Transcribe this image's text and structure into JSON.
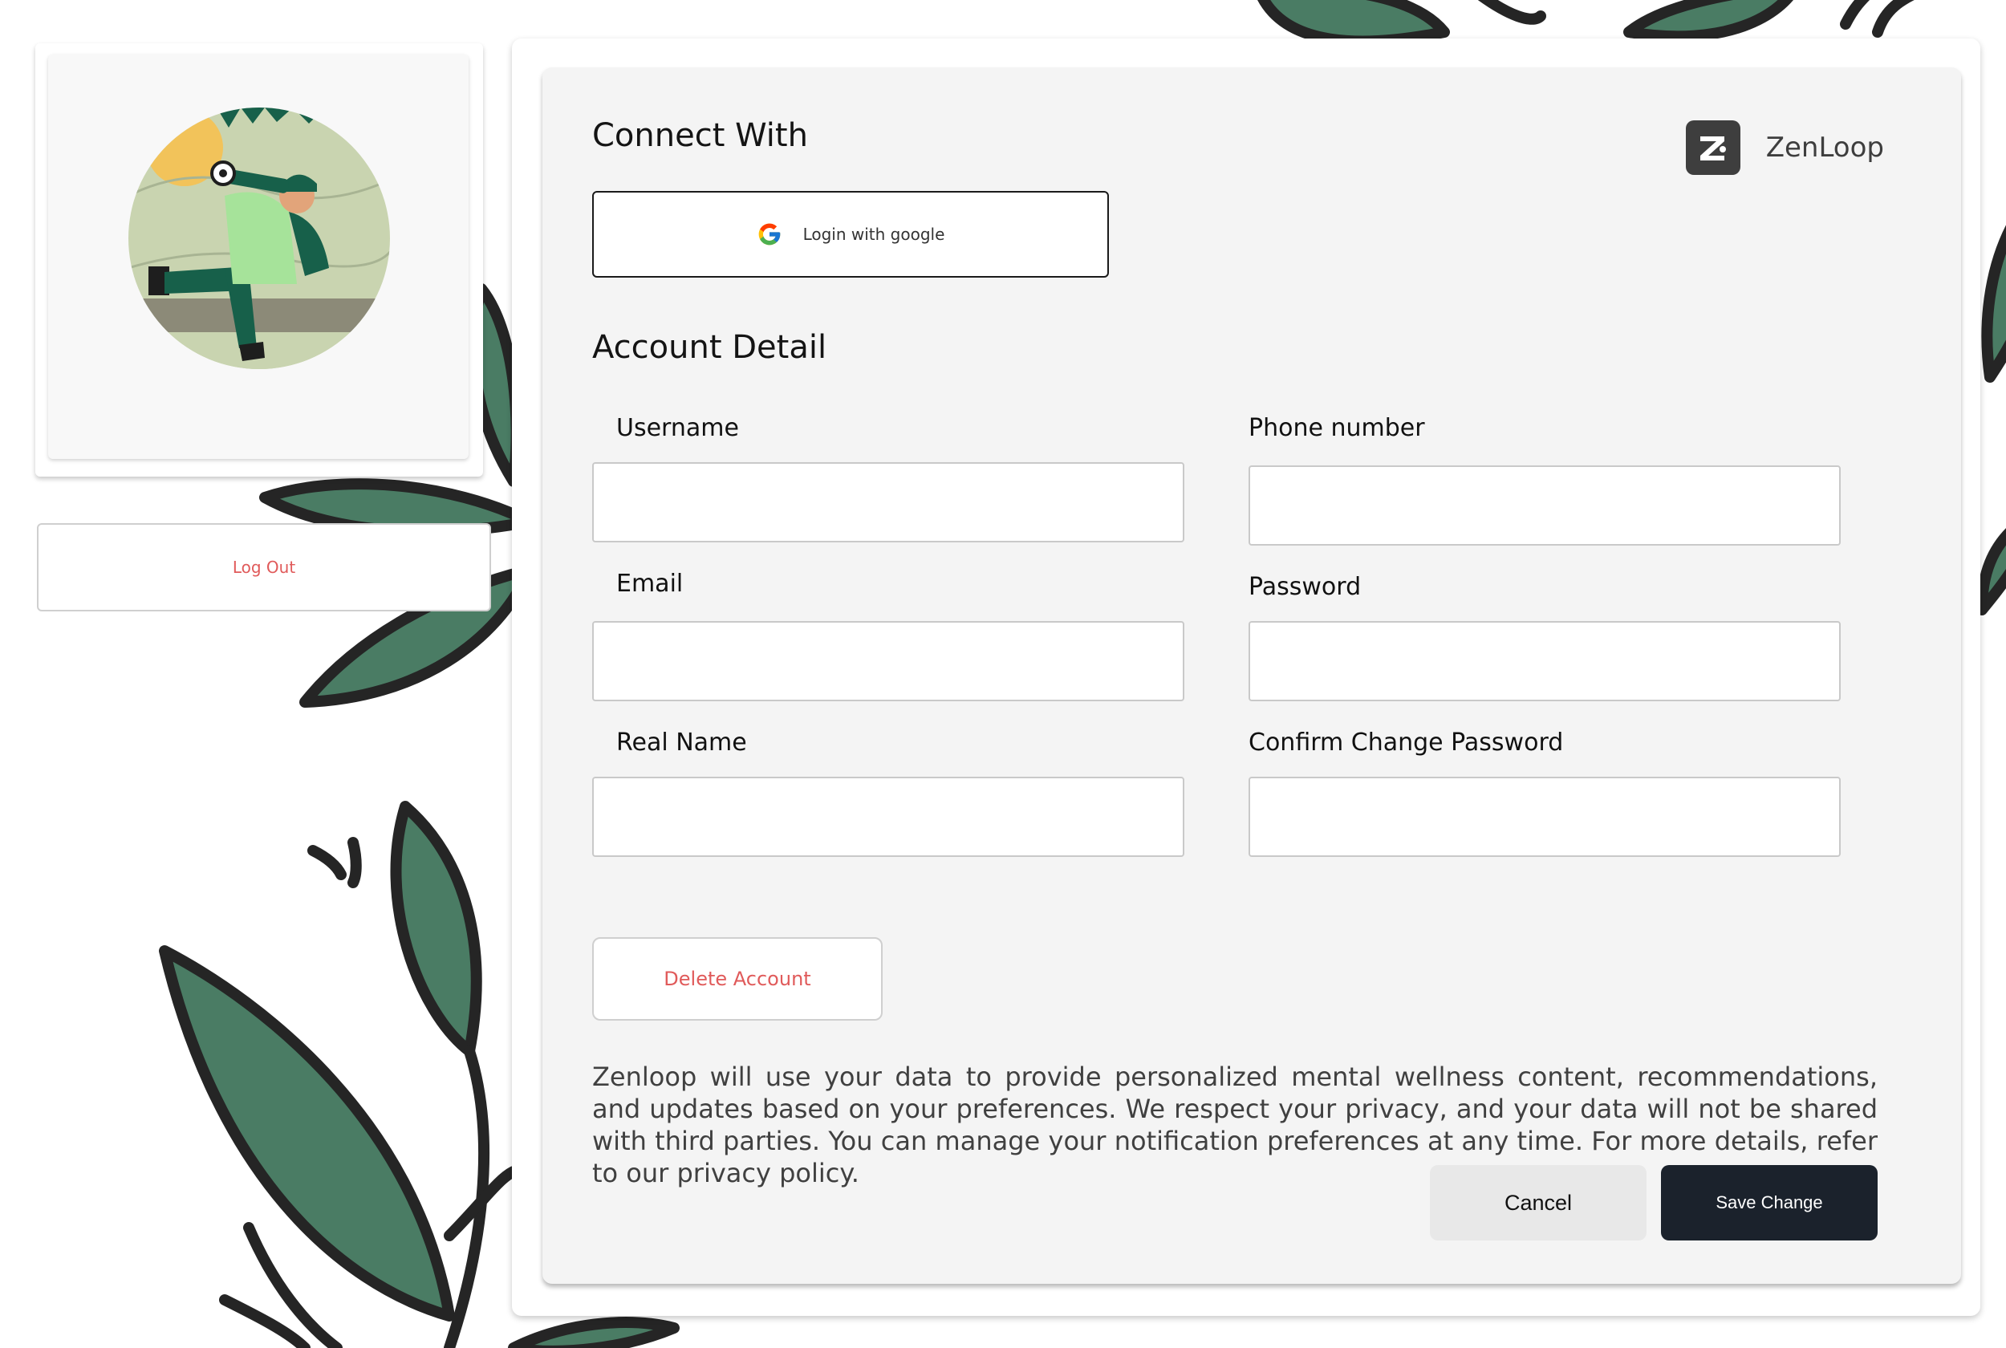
{
  "sidebar": {
    "avatar_alt": "person-with-telescope-illustration",
    "logout_label": "Log Out"
  },
  "header": {
    "connect_title": "Connect With",
    "brand_name": "ZenLoop",
    "brand_icon_letter": "Z"
  },
  "google_login": {
    "icon": "google-icon",
    "label": "Login with google"
  },
  "account": {
    "title": "Account Detail",
    "fields": {
      "username": {
        "label": "Username",
        "value": ""
      },
      "phone": {
        "label": "Phone number",
        "value": ""
      },
      "email": {
        "label": "Email",
        "value": ""
      },
      "password": {
        "label": "Password",
        "value": ""
      },
      "real_name": {
        "label": "Real Name",
        "value": ""
      },
      "confirm_password": {
        "label": "Confirm Change Password",
        "value": ""
      }
    },
    "delete_label": "Delete Account"
  },
  "notice": "Zenloop will use your data to provide personalized mental wellness content, recommendations, and updates based on your preferences. We respect your privacy, and your data will not be shared with third parties. You can manage your notification preferences at any time. For more details, refer to our privacy policy.",
  "actions": {
    "cancel_label": "Cancel",
    "save_label": "Save Change"
  },
  "colors": {
    "accent_danger": "#e05a5a",
    "primary_dark": "#1b222c",
    "leaf_green": "#4a7c64",
    "panel_bg": "#f4f4f4"
  }
}
